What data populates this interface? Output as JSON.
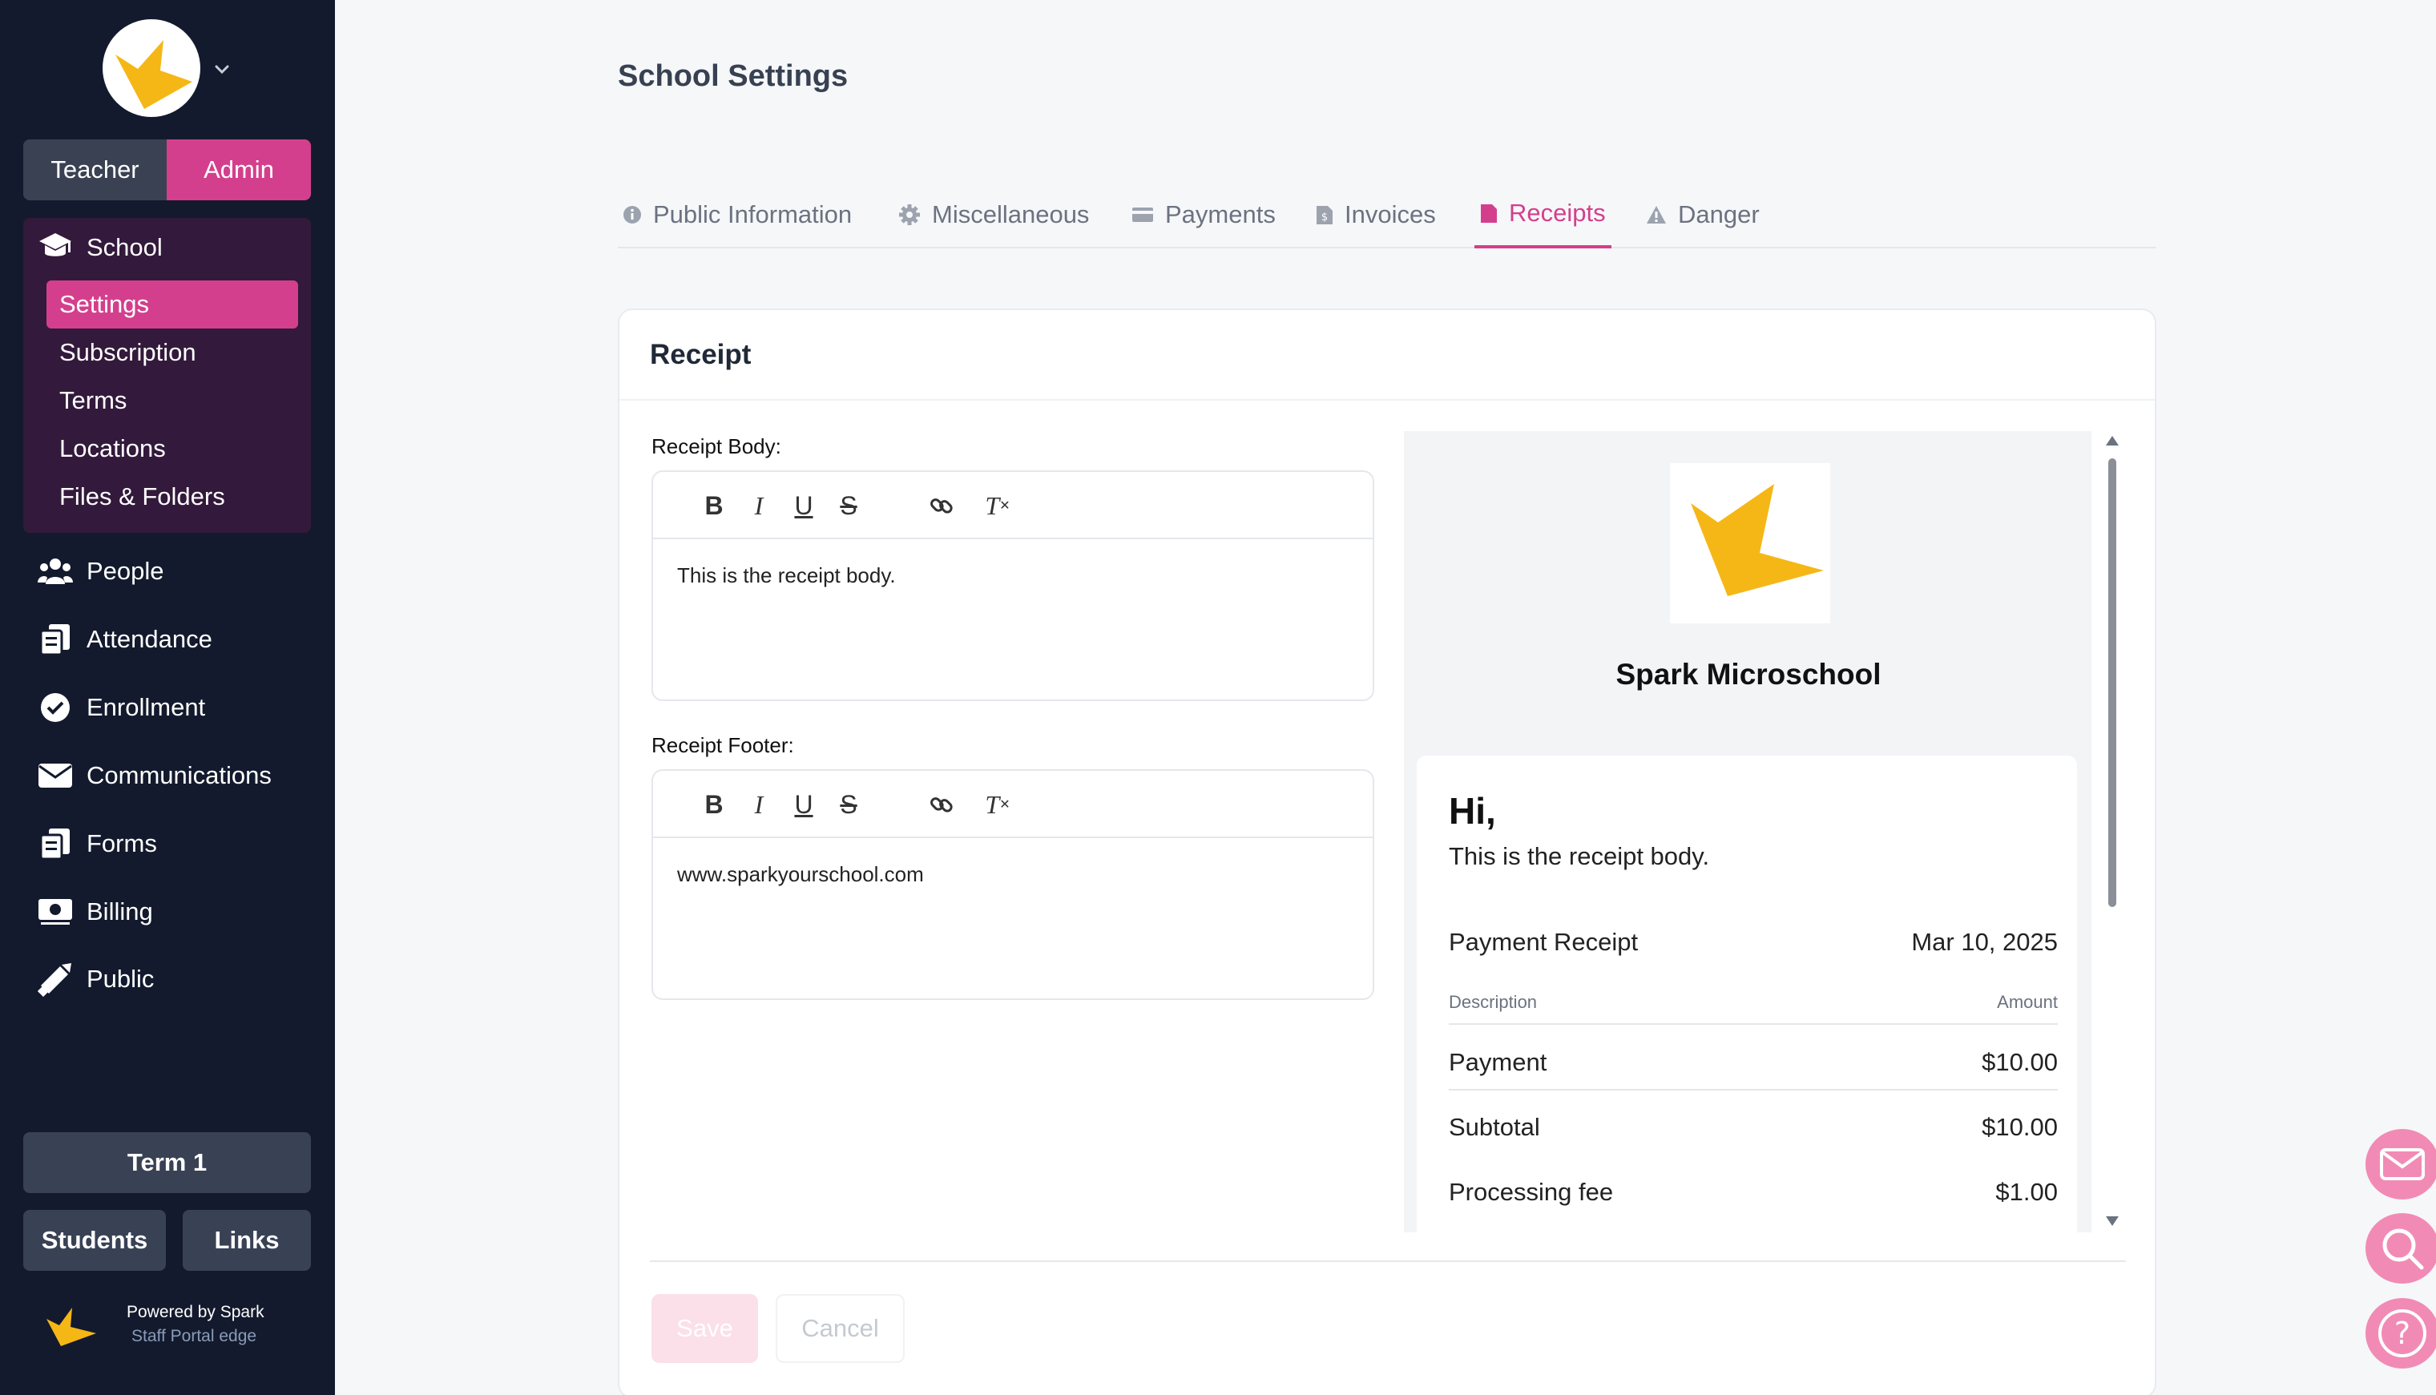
{
  "sidebar": {
    "role_toggle": {
      "teacher": "Teacher",
      "admin": "Admin"
    },
    "school": {
      "label": "School",
      "sub_items": [
        "Settings",
        "Subscription",
        "Terms",
        "Locations",
        "Files & Folders"
      ]
    },
    "nav_items": [
      "People",
      "Attendance",
      "Enrollment",
      "Communications",
      "Forms",
      "Billing",
      "Public"
    ],
    "term_button": "Term 1",
    "students_button": "Students",
    "links_button": "Links",
    "powered_by": "Powered by Spark",
    "portal_edge": "Staff Portal edge"
  },
  "header": {
    "title": "School Settings"
  },
  "tabs": [
    "Public Information",
    "Miscellaneous",
    "Payments",
    "Invoices",
    "Receipts",
    "Danger"
  ],
  "active_tab": "Receipts",
  "receipt": {
    "card_title": "Receipt",
    "body_label": "Receipt Body:",
    "body_text": "This is the receipt body.",
    "footer_label": "Receipt Footer:",
    "footer_text": "www.sparkyourschool.com",
    "save_label": "Save",
    "cancel_label": "Cancel"
  },
  "preview": {
    "school_name": "Spark Microschool",
    "greeting": "Hi,",
    "body": "This is the receipt body.",
    "receipt_title": "Payment Receipt",
    "date": "Mar 10, 2025",
    "col_description": "Description",
    "col_amount": "Amount",
    "lines": [
      {
        "label": "Payment",
        "amount": "$10.00"
      },
      {
        "label": "Subtotal",
        "amount": "$10.00"
      },
      {
        "label": "Processing fee",
        "amount": "$1.00"
      }
    ]
  },
  "colors": {
    "brand": "#d43f8d",
    "sidebar_bg": "#131a2d",
    "logo_yellow": "#f5b716"
  },
  "icons": [
    "mail-icon",
    "search-icon",
    "help-icon"
  ]
}
